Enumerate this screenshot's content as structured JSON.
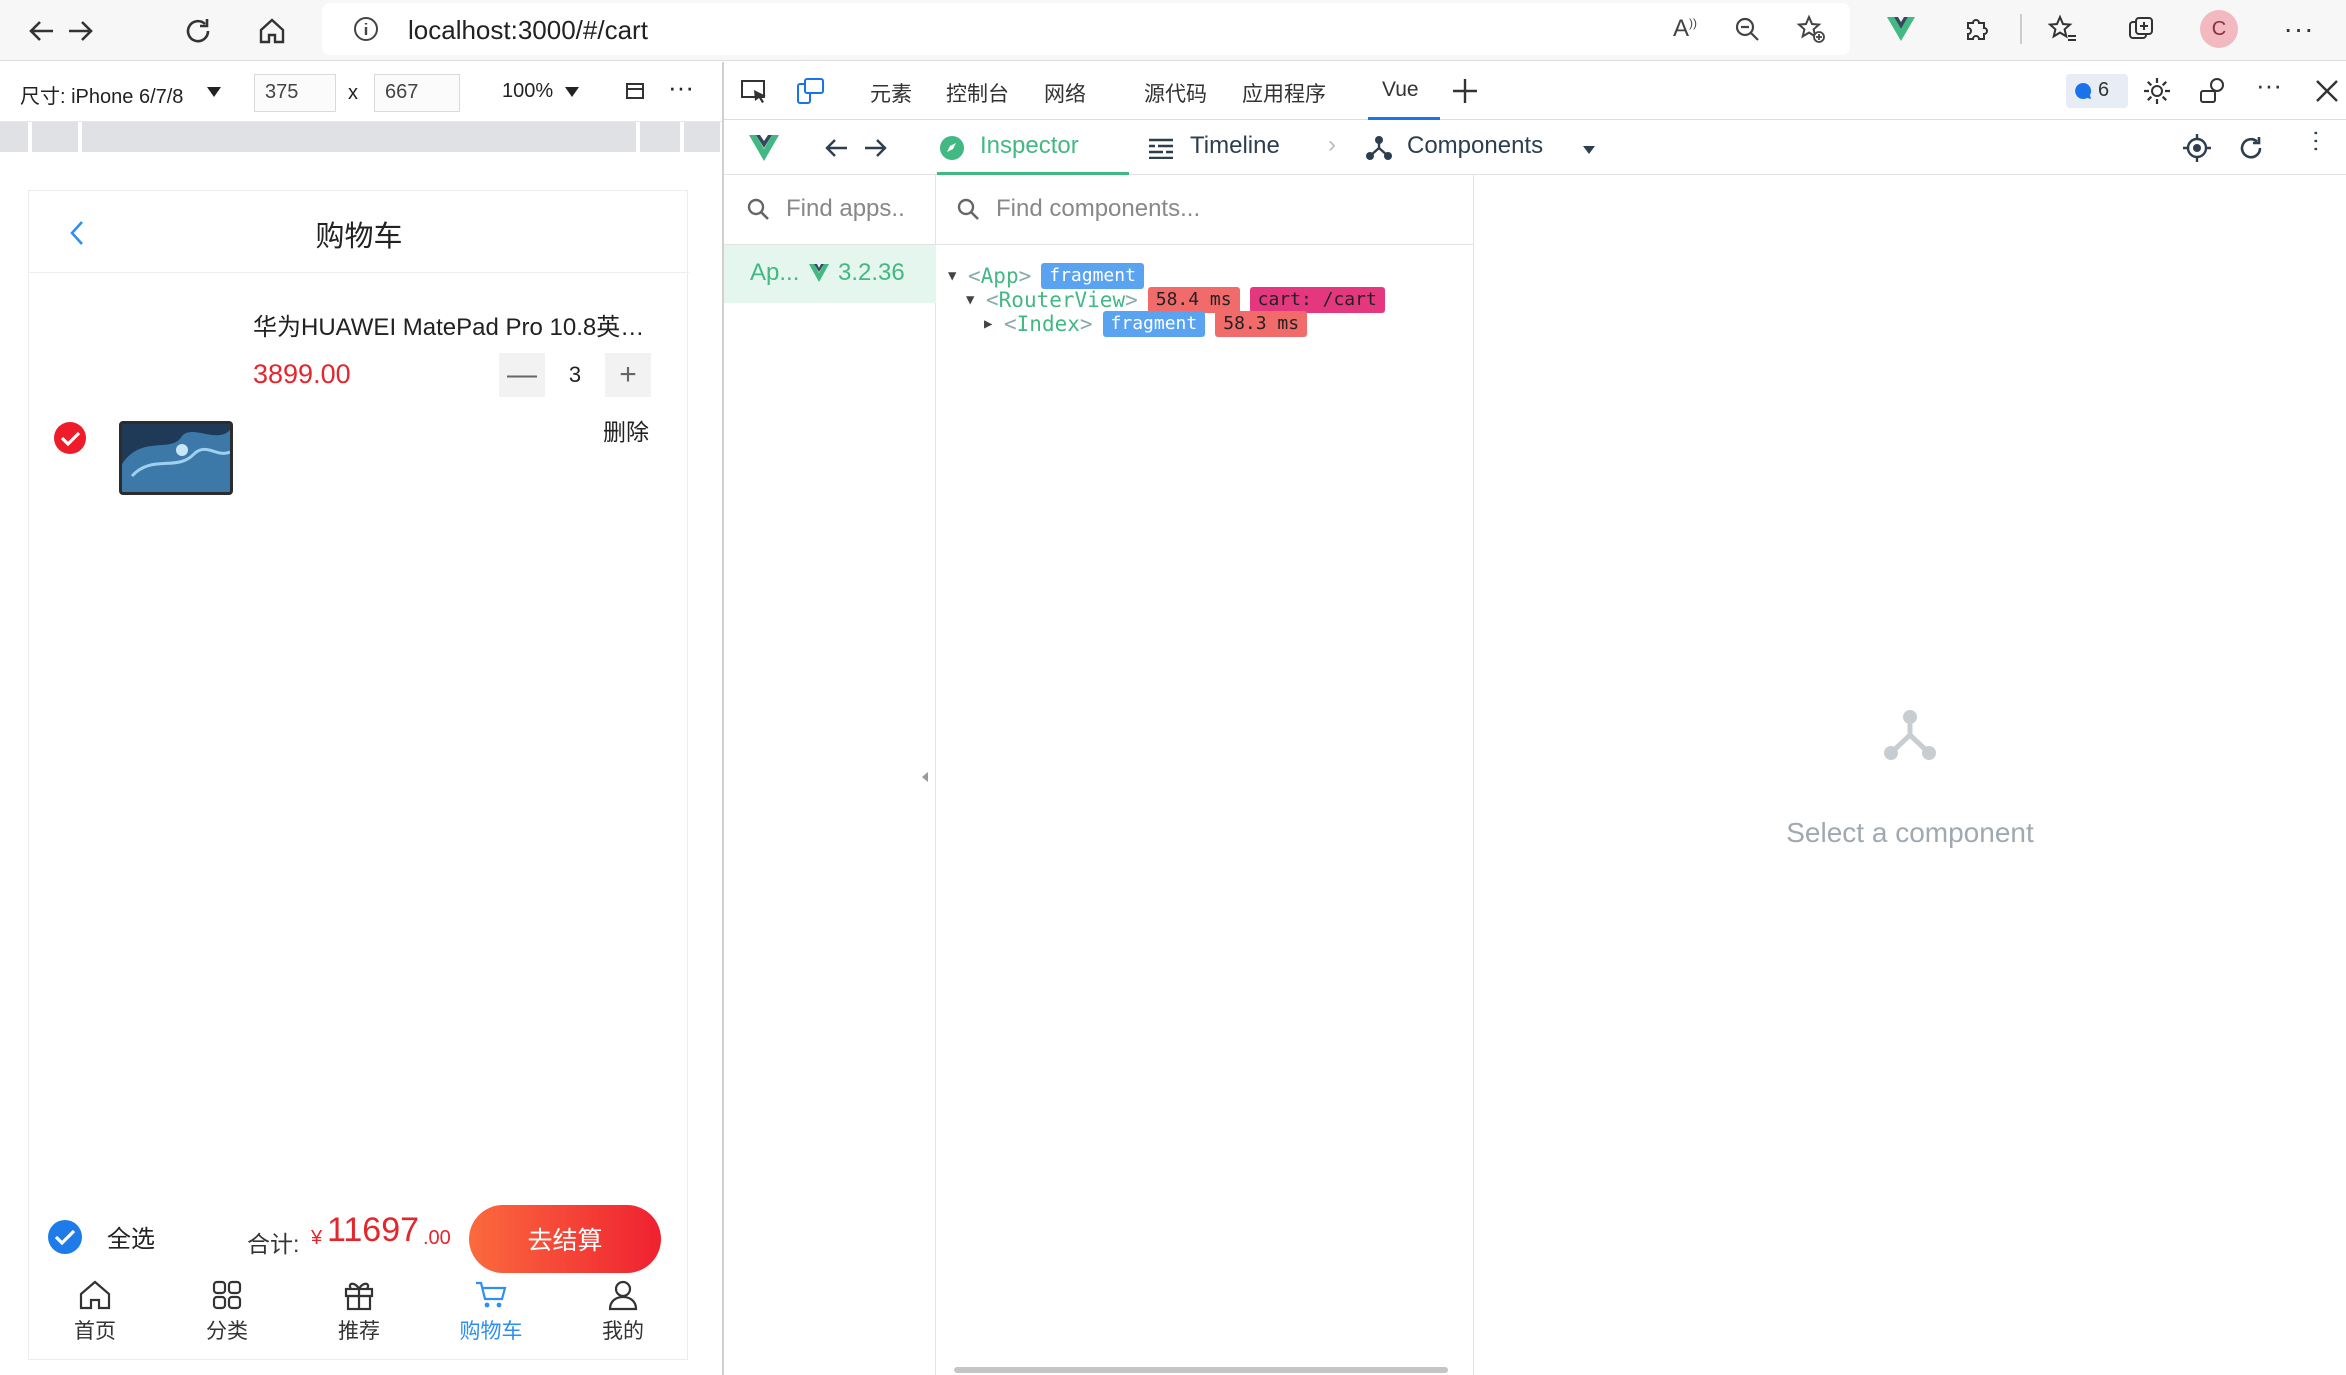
{
  "browser": {
    "url_host": "localhost:3000/#/cart",
    "avatar_initial": "C"
  },
  "device_toolbar": {
    "device_label": "尺寸: iPhone 6/7/8",
    "width": "375",
    "times": "x",
    "height": "667",
    "zoom": "100%"
  },
  "phone": {
    "page_title": "购物车",
    "item": {
      "title": "华为HUAWEI MatePad Pro 10.8英…",
      "price": "3899.00",
      "quantity": "3",
      "minus": "—",
      "plus": "+",
      "delete": "删除",
      "checked": true
    },
    "checkout": {
      "select_all": "全选",
      "total_label": "合计:",
      "currency": "¥",
      "total_amount": "11697",
      "total_decimals": ".00",
      "button": "去结算"
    },
    "tabbar": [
      {
        "label": "首页",
        "icon": "home-icon"
      },
      {
        "label": "分类",
        "icon": "grid-icon"
      },
      {
        "label": "推荐",
        "icon": "gift-icon"
      },
      {
        "label": "购物车",
        "icon": "cart-icon",
        "active": true
      },
      {
        "label": "我的",
        "icon": "user-icon"
      }
    ],
    "accent": "#2f8ff0",
    "price_color": "#e4262d"
  },
  "devtools": {
    "tabs": [
      "元素",
      "控制台",
      "网络",
      "源代码",
      "应用程序",
      "Vue"
    ],
    "active_tab": "Vue",
    "issues_count": "6",
    "vue": {
      "inspector": "Inspector",
      "timeline": "Timeline",
      "components": "Components",
      "find_apps": "Find apps..",
      "find_components": "Find components...",
      "app_name": "Ap...",
      "app_version": "3.2.36",
      "tree": {
        "app": {
          "name": "App",
          "badge": "fragment"
        },
        "router_view": {
          "name": "RouterView",
          "time": "58.4 ms",
          "route": "cart: /cart"
        },
        "index": {
          "name": "Index",
          "badge": "fragment",
          "time": "58.3 ms"
        }
      },
      "empty_state": "Select a component",
      "accent": "#42b883"
    }
  }
}
